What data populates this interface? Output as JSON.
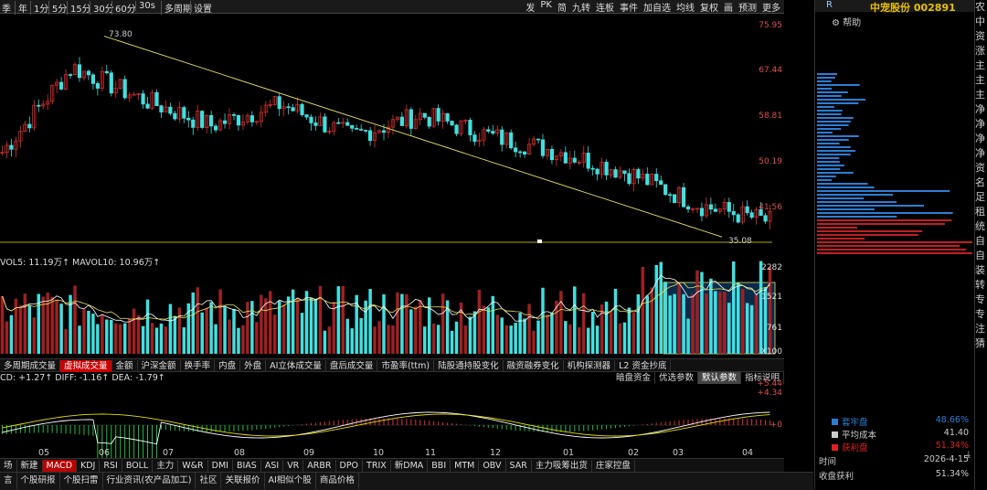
{
  "toolbar": {
    "periods": [
      "季",
      "年",
      "1分",
      "5分",
      "15分",
      "30分",
      "60分",
      "30s"
    ],
    "extra": [
      "多周期",
      "设置"
    ],
    "right_items": [
      "发",
      "PK",
      "简",
      "九转",
      "连板",
      "事件",
      "加自选",
      "均线",
      "复权",
      "画",
      "预测",
      "更多"
    ]
  },
  "chart": {
    "price_ticks": [
      "75.95",
      "67.44",
      "58.81",
      "50.19",
      "41.56"
    ],
    "high_label": "73.80",
    "low_label": "35.08",
    "vol_legend": "VOL5: 11.19万↑  MAVOL10: 10.96万↑",
    "vol_ticks": [
      "2282",
      "1521",
      "761",
      "X100"
    ],
    "macd_legend": "CD: +1.27↑  DIFF: -1.16↑  DEA: -1.79↑",
    "macd_ticks": [
      "+5.44",
      "+4.34",
      "+0"
    ],
    "x_labels": [
      "05",
      "06",
      "07",
      "08",
      "09",
      "10",
      "11",
      "12",
      "01",
      "02",
      "03",
      "04"
    ],
    "vol_tabs": [
      "多周期成交量",
      "虚拟成交量",
      "金额",
      "沪深金额",
      "换手率",
      "内盘",
      "外盘",
      "AI立体成交量",
      "盘后成交量",
      "市盈率(ttm)",
      "陆股通持股变化",
      "融资融券变化",
      "机构探测器",
      "L2 资金抄底"
    ],
    "vol_tab_active": "虚拟成交量",
    "macd_tabs": [
      "暗盘资金",
      "优选参数",
      "默认参数",
      "指标说明"
    ],
    "ind_tabs": [
      "场",
      "新建",
      "MACD",
      "KDJ",
      "RSI",
      "BOLL",
      "主力",
      "W&R",
      "DMI",
      "BIAS",
      "ASI",
      "VR",
      "ARBR",
      "DPO",
      "TRIX",
      "新DMA",
      "BBI",
      "MTM",
      "OBV",
      "SAR",
      "主力吸筹出货",
      "庄家控盘"
    ],
    "ind_active": "MACD",
    "bottom_tabs": [
      "言",
      "个股研报",
      "个股扫雷",
      "行业资讯(农产品加工)",
      "社区",
      "关联报价",
      "AI相似个股",
      "商品价格"
    ]
  },
  "right_panel": {
    "code_title": "中宠股份 002891",
    "r_label": "R",
    "help": "帮助",
    "legend": [
      {
        "label": "套牢盘",
        "value": "48.66%",
        "color": "#2a7fd4"
      },
      {
        "label": "平均成本",
        "value": "41.40",
        "color": "#cccccc"
      },
      {
        "label": "获利盘",
        "value": "51.34%",
        "color": "#e02020"
      }
    ],
    "stats": [
      {
        "label": "时间",
        "value": "2026-4-15"
      },
      {
        "label": "收盘获利",
        "value": "51.34%"
      }
    ]
  },
  "far_right": [
    "农",
    "中",
    "资",
    "涨",
    "主",
    "主",
    "主",
    "净",
    "净",
    "净",
    "净",
    "资",
    "名",
    "足",
    "租",
    "统",
    "自",
    "自",
    "装",
    "转",
    "专",
    "专",
    "注",
    "猜"
  ],
  "chart_data": {
    "type": "candlestick",
    "x": [
      "05",
      "06",
      "07",
      "08",
      "09",
      "10",
      "11",
      "12",
      "01",
      "02",
      "03",
      "04"
    ],
    "close_approx": [
      52,
      68,
      62,
      57,
      61,
      55,
      59,
      55,
      52,
      48,
      42,
      39
    ],
    "ylim": [
      35.08,
      75.95
    ],
    "high": 73.8,
    "low": 35.08
  }
}
